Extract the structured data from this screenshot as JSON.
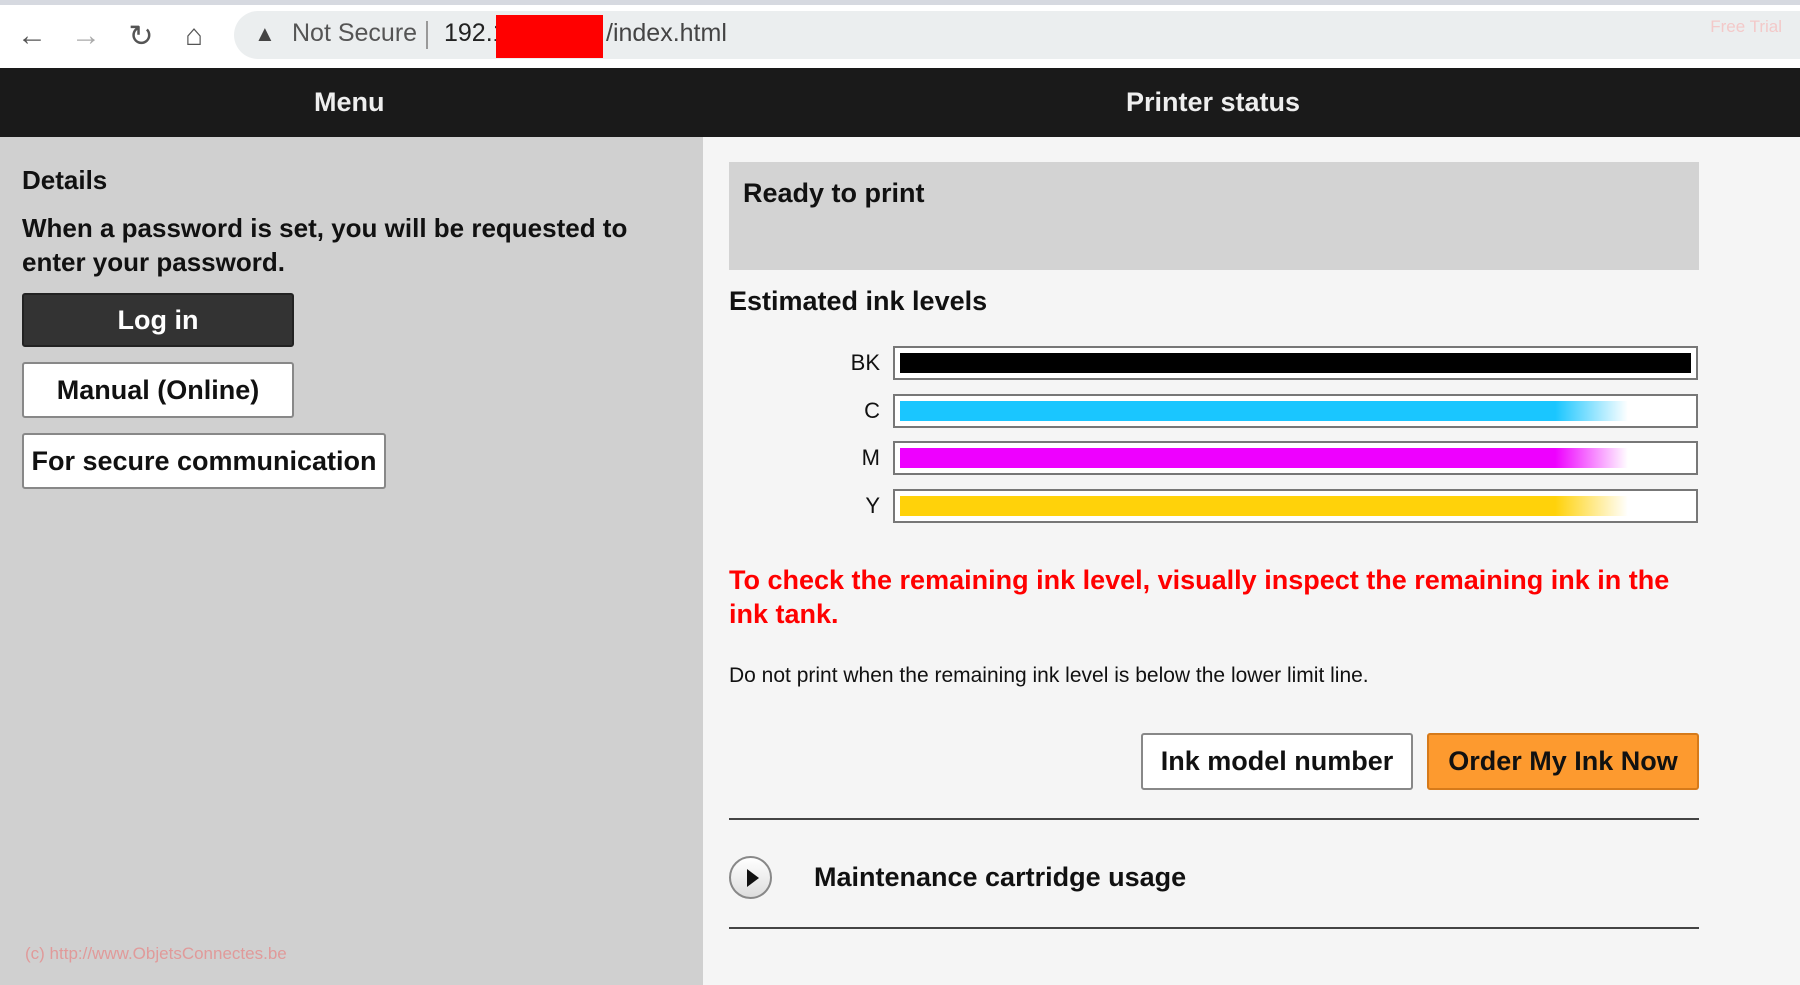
{
  "browser": {
    "not_secure": "Not Secure",
    "url_prefix": "192.1",
    "url_suffix": "/index.html",
    "watermark": "Free Trial"
  },
  "header": {
    "menu": "Menu",
    "title": "Printer status"
  },
  "sidebar": {
    "details": "Details",
    "description": "When a password is set, you will be requested to enter your password.",
    "login": "Log in",
    "manual": "Manual (Online)",
    "secure": "For secure communication",
    "footer": "(c) http://www.ObjetsConnectes.be"
  },
  "main": {
    "status": "Ready to print",
    "ink_heading": "Estimated ink levels",
    "inks": [
      {
        "label": "BK",
        "level": 100,
        "color": "#000000"
      },
      {
        "label": "C",
        "level": 92,
        "color": "#1ac6ff"
      },
      {
        "label": "M",
        "level": 92,
        "color": "#ee00ff"
      },
      {
        "label": "Y",
        "level": 92,
        "color": "#ffd20a"
      }
    ],
    "warning": "To check the remaining ink level, visually inspect the remaining ink in the ink tank.",
    "note": "Do not print when the remaining ink level is below the lower limit line.",
    "ink_model": "Ink model number",
    "order": "Order My Ink Now",
    "maintenance": "Maintenance cartridge usage"
  }
}
